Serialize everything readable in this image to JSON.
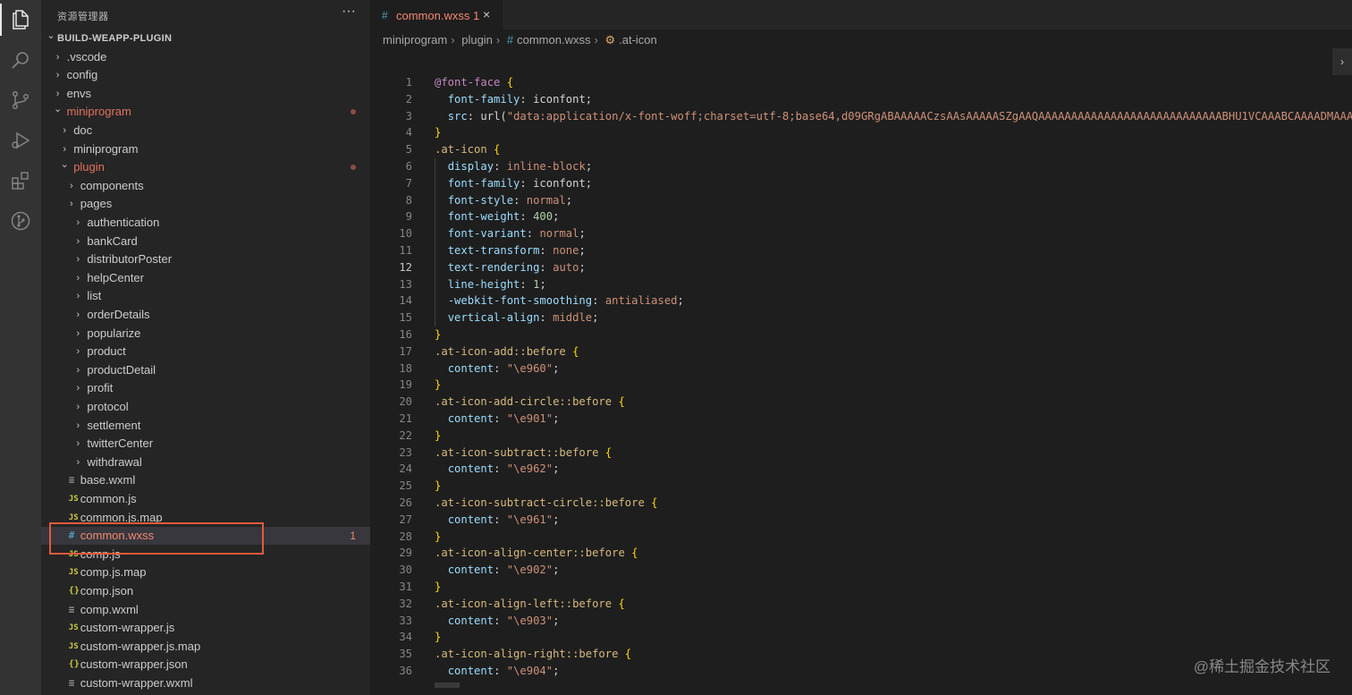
{
  "activity_bar": {
    "icons": [
      "files-icon",
      "search-icon",
      "source-control-icon",
      "run-debug-icon",
      "extensions-icon",
      "git-graph-icon"
    ]
  },
  "sidebar": {
    "title": "资源管理器",
    "more": "···",
    "tree": [
      {
        "label": "BUILD-WEAPP-PLUGIN",
        "type": "root"
      },
      {
        "label": ".vscode",
        "type": "folder"
      },
      {
        "label": "config",
        "type": "folder"
      },
      {
        "label": "envs",
        "type": "folder"
      },
      {
        "label": "miniprogram",
        "type": "folder-open",
        "modified": true
      },
      {
        "label": "doc",
        "type": "folder"
      },
      {
        "label": "miniprogram",
        "type": "folder"
      },
      {
        "label": "plugin",
        "type": "folder-open",
        "modified": true
      },
      {
        "label": "components",
        "type": "folder"
      },
      {
        "label": "pages",
        "type": "folder"
      },
      {
        "label": "authentication",
        "type": "folder"
      },
      {
        "label": "bankCard",
        "type": "folder"
      },
      {
        "label": "distributorPoster",
        "type": "folder"
      },
      {
        "label": "helpCenter",
        "type": "folder"
      },
      {
        "label": "list",
        "type": "folder"
      },
      {
        "label": "orderDetails",
        "type": "folder"
      },
      {
        "label": "popularize",
        "type": "folder"
      },
      {
        "label": "product",
        "type": "folder"
      },
      {
        "label": "productDetail",
        "type": "folder"
      },
      {
        "label": "profit",
        "type": "folder"
      },
      {
        "label": "protocol",
        "type": "folder"
      },
      {
        "label": "settlement",
        "type": "folder"
      },
      {
        "label": "twitterCenter",
        "type": "folder"
      },
      {
        "label": "withdrawal",
        "type": "folder"
      },
      {
        "label": "base.wxml",
        "type": "wxml"
      },
      {
        "label": "common.js",
        "type": "js"
      },
      {
        "label": "common.js.map",
        "type": "js"
      },
      {
        "label": "common.wxss",
        "type": "wxss",
        "errors": "1",
        "selected": true
      },
      {
        "label": "comp.js",
        "type": "js"
      },
      {
        "label": "comp.js.map",
        "type": "js"
      },
      {
        "label": "comp.json",
        "type": "json"
      },
      {
        "label": "comp.wxml",
        "type": "wxml"
      },
      {
        "label": "custom-wrapper.js",
        "type": "js"
      },
      {
        "label": "custom-wrapper.js.map",
        "type": "js"
      },
      {
        "label": "custom-wrapper.json",
        "type": "json"
      },
      {
        "label": "custom-wrapper.wxml",
        "type": "wxml"
      }
    ]
  },
  "editor": {
    "tab": {
      "name": "common.wxss",
      "errors": "1",
      "close": "×",
      "icon": "#"
    },
    "breadcrumb": [
      "miniprogram",
      "plugin",
      "common.wxss",
      ".at-icon"
    ],
    "current_line": 12,
    "lines": [
      [
        [
          "@font-face",
          "at"
        ],
        [
          " ",
          "plain"
        ],
        [
          "{",
          "brace"
        ]
      ],
      [
        [
          "  ",
          "plain"
        ],
        [
          "font-family",
          "prop"
        ],
        [
          ": iconfont;",
          "plain"
        ]
      ],
      [
        [
          "  ",
          "plain"
        ],
        [
          "src",
          "prop"
        ],
        [
          ": ",
          "plain"
        ],
        [
          "url(",
          "plain"
        ],
        [
          "\"data:application/x-font-woff;charset=utf-8;base64,d09GRgABAAAAACzsAAsAAAAASZgAAQAAAAAAAAAAAAAAAAAAAAAAAAAAAABHU1VCAAABCAAAADMAAAA",
          "str"
        ]
      ],
      [
        [
          "}",
          "brace"
        ]
      ],
      [
        [
          ".at-icon",
          "sel"
        ],
        [
          " ",
          "plain"
        ],
        [
          "{",
          "brace"
        ]
      ],
      [
        [
          "  ",
          "plain"
        ],
        [
          "display",
          "prop"
        ],
        [
          ": ",
          "plain"
        ],
        [
          "inline-block",
          "val"
        ],
        [
          ";",
          "plain"
        ]
      ],
      [
        [
          "  ",
          "plain"
        ],
        [
          "font-family",
          "prop"
        ],
        [
          ": iconfont;",
          "plain"
        ]
      ],
      [
        [
          "  ",
          "plain"
        ],
        [
          "font-style",
          "prop"
        ],
        [
          ": ",
          "plain"
        ],
        [
          "normal",
          "val"
        ],
        [
          ";",
          "plain"
        ]
      ],
      [
        [
          "  ",
          "plain"
        ],
        [
          "font-weight",
          "prop"
        ],
        [
          ": ",
          "plain"
        ],
        [
          "400",
          "num"
        ],
        [
          ";",
          "plain"
        ]
      ],
      [
        [
          "  ",
          "plain"
        ],
        [
          "font-variant",
          "prop"
        ],
        [
          ": ",
          "plain"
        ],
        [
          "normal",
          "val"
        ],
        [
          ";",
          "plain"
        ]
      ],
      [
        [
          "  ",
          "plain"
        ],
        [
          "text-transform",
          "prop"
        ],
        [
          ": ",
          "plain"
        ],
        [
          "none",
          "val"
        ],
        [
          ";",
          "plain"
        ]
      ],
      [
        [
          "  ",
          "plain"
        ],
        [
          "text-rendering",
          "prop"
        ],
        [
          ": ",
          "plain"
        ],
        [
          "auto",
          "val"
        ],
        [
          ";",
          "plain"
        ]
      ],
      [
        [
          "  ",
          "plain"
        ],
        [
          "line-height",
          "prop"
        ],
        [
          ": ",
          "plain"
        ],
        [
          "1",
          "num"
        ],
        [
          ";",
          "plain"
        ]
      ],
      [
        [
          "  ",
          "plain"
        ],
        [
          "-webkit-font-smoothing",
          "prop"
        ],
        [
          ": ",
          "plain"
        ],
        [
          "antialiased",
          "val"
        ],
        [
          ";",
          "plain"
        ]
      ],
      [
        [
          "  ",
          "plain"
        ],
        [
          "vertical-align",
          "prop"
        ],
        [
          ": ",
          "plain"
        ],
        [
          "middle",
          "val"
        ],
        [
          ";",
          "plain"
        ]
      ],
      [
        [
          "}",
          "brace"
        ]
      ],
      [
        [
          ".at-icon-add::before",
          "sel"
        ],
        [
          " ",
          "plain"
        ],
        [
          "{",
          "brace"
        ]
      ],
      [
        [
          "  ",
          "plain"
        ],
        [
          "content",
          "prop"
        ],
        [
          ": ",
          "plain"
        ],
        [
          "\"\\e960\"",
          "str"
        ],
        [
          ";",
          "plain"
        ]
      ],
      [
        [
          "}",
          "brace"
        ]
      ],
      [
        [
          ".at-icon-add-circle::before",
          "sel"
        ],
        [
          " ",
          "plain"
        ],
        [
          "{",
          "brace"
        ]
      ],
      [
        [
          "  ",
          "plain"
        ],
        [
          "content",
          "prop"
        ],
        [
          ": ",
          "plain"
        ],
        [
          "\"\\e901\"",
          "str"
        ],
        [
          ";",
          "plain"
        ]
      ],
      [
        [
          "}",
          "brace"
        ]
      ],
      [
        [
          ".at-icon-subtract::before",
          "sel"
        ],
        [
          " ",
          "plain"
        ],
        [
          "{",
          "brace"
        ]
      ],
      [
        [
          "  ",
          "plain"
        ],
        [
          "content",
          "prop"
        ],
        [
          ": ",
          "plain"
        ],
        [
          "\"\\e962\"",
          "str"
        ],
        [
          ";",
          "plain"
        ]
      ],
      [
        [
          "}",
          "brace"
        ]
      ],
      [
        [
          ".at-icon-subtract-circle::before",
          "sel"
        ],
        [
          " ",
          "plain"
        ],
        [
          "{",
          "brace"
        ]
      ],
      [
        [
          "  ",
          "plain"
        ],
        [
          "content",
          "prop"
        ],
        [
          ": ",
          "plain"
        ],
        [
          "\"\\e961\"",
          "str"
        ],
        [
          ";",
          "plain"
        ]
      ],
      [
        [
          "}",
          "brace"
        ]
      ],
      [
        [
          ".at-icon-align-center::before",
          "sel"
        ],
        [
          " ",
          "plain"
        ],
        [
          "{",
          "brace"
        ]
      ],
      [
        [
          "  ",
          "plain"
        ],
        [
          "content",
          "prop"
        ],
        [
          ": ",
          "plain"
        ],
        [
          "\"\\e902\"",
          "str"
        ],
        [
          ";",
          "plain"
        ]
      ],
      [
        [
          "}",
          "brace"
        ]
      ],
      [
        [
          ".at-icon-align-left::before",
          "sel"
        ],
        [
          " ",
          "plain"
        ],
        [
          "{",
          "brace"
        ]
      ],
      [
        [
          "  ",
          "plain"
        ],
        [
          "content",
          "prop"
        ],
        [
          ": ",
          "plain"
        ],
        [
          "\"\\e903\"",
          "str"
        ],
        [
          ";",
          "plain"
        ]
      ],
      [
        [
          "}",
          "brace"
        ]
      ],
      [
        [
          ".at-icon-align-right::before",
          "sel"
        ],
        [
          " ",
          "plain"
        ],
        [
          "{",
          "brace"
        ]
      ],
      [
        [
          "  ",
          "plain"
        ],
        [
          "content",
          "prop"
        ],
        [
          ": ",
          "plain"
        ],
        [
          "\"\\e904\"",
          "str"
        ],
        [
          ";",
          "plain"
        ]
      ]
    ]
  },
  "watermark": "@稀土掘金技术社区"
}
